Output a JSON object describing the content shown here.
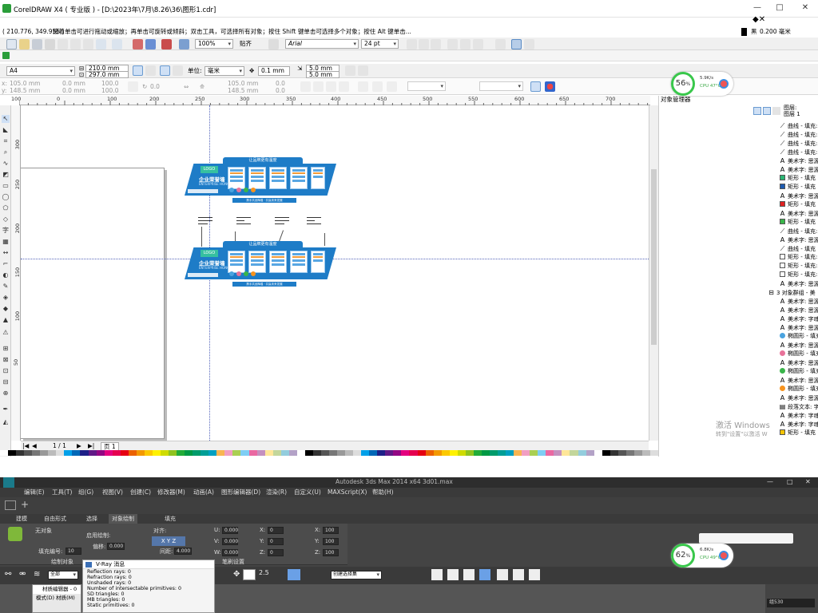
{
  "cdr": {
    "title": "CorelDRAW X4 ( 专业版 ) - [D:\\2023年\\7月\\8.26\\36\\图形1.cdr]",
    "window_controls": {
      "min": "—",
      "max": "□",
      "close": "✕"
    },
    "status": {
      "coords": "( 210.776, 349.955 )",
      "hint": "接着单击可进行拖动或缩放；再单击可旋转或倾斜；双击工具，可选择所有对象；按住 Shift 键单击可选择多个对象；按住 Alt 键单击...",
      "outline_label": "黑",
      "outline_width": "0.200 毫米"
    },
    "toolbar1": {
      "zoom": "100%",
      "snap": "贴齐",
      "font": "Arial",
      "font_size": "24 pt"
    },
    "propbar": {
      "paper": "A4",
      "width": "210.0 mm",
      "height": "297.0 mm",
      "units_label": "单位:",
      "units": "毫米",
      "nudge": "0.1 mm",
      "dup_x": "5.0 mm",
      "dup_y": "5.0 mm"
    },
    "propbar2": {
      "x": "105.0 mm",
      "y": "148.5 mm",
      "w": "0.0 mm",
      "h": "0.0 mm",
      "sx": "100.0",
      "sy": "100.0",
      "angle": "0.0",
      "cx": "105.0 mm",
      "cy": "148.5 mm",
      "v1": "0.0",
      "v2": "0.0"
    },
    "ruler_h_ticks": [
      "100",
      "50",
      "0",
      "50",
      "100",
      "150",
      "200",
      "250",
      "300",
      "350",
      "400",
      "450",
      "500",
      "550",
      "600",
      "650",
      "700"
    ],
    "ruler_v_ticks": [
      "300",
      "250",
      "200",
      "150",
      "100",
      "50",
      "0"
    ],
    "page_nav": {
      "counter": "1 / 1",
      "page_tab": "页 1"
    },
    "design": {
      "top_title": "让品牌更有温度",
      "badge": "LOGO",
      "company": "企业荣誉墙",
      "subtitle": "ENTERPRISE HONOR WALL",
      "footer": "携手共创辉煌 · 共赢未来发展",
      "top_title2": "让品牌更有温度",
      "badge2": "LOGO",
      "company2": "企业荣誉墙",
      "subtitle2": "ENTERPRISE HONOR WALL",
      "footer2": "携手共创辉煌 · 共赢未来发展"
    },
    "object_manager": {
      "title": "对象管理器",
      "layers": [
        "图层:",
        "图层 1"
      ],
      "rows": [
        {
          "icon": "curve",
          "text": "曲线 - 填充: 无"
        },
        {
          "icon": "curve",
          "text": "曲线 - 填充: 无"
        },
        {
          "icon": "curve",
          "text": "曲线 - 填充: 无"
        },
        {
          "icon": "curve",
          "text": "曲线 - 填充: 无"
        },
        {
          "icon": "text",
          "text": "美术字: 思源"
        },
        {
          "icon": "text",
          "text": "美术字: 思源"
        },
        {
          "icon": "rect",
          "color": "#2bb673",
          "text": "矩形 - 填充"
        },
        {
          "icon": "rect",
          "color": "#1e5bb0",
          "text": "矩形 - 填充"
        },
        {
          "icon": "text",
          "text": "美术字: 思源"
        },
        {
          "icon": "rect",
          "color": "#e02020",
          "text": "矩形 - 填充"
        },
        {
          "icon": "text",
          "text": "美术字: 思源"
        },
        {
          "icon": "rect",
          "color": "#39b54a",
          "text": "矩形 - 填充"
        },
        {
          "icon": "curve",
          "text": "曲线 - 填充: 白"
        },
        {
          "icon": "text",
          "text": "美术字: 思源"
        },
        {
          "icon": "curve",
          "text": "曲线 - 填充"
        },
        {
          "icon": "rect",
          "color": "#ffffff",
          "text": "矩形 - 填充: 白"
        },
        {
          "icon": "rect",
          "color": "#ffffff",
          "text": "矩形 - 填充: 白"
        },
        {
          "icon": "rect",
          "color": "#ffffff",
          "text": "矩形 - 填充: 白"
        },
        {
          "icon": "text",
          "text": "美术字: 思源"
        }
      ],
      "group": "3 对象群组 - 美",
      "group_rows": [
        {
          "icon": "text",
          "text": "美术字: 思源"
        },
        {
          "icon": "text",
          "text": "美术字: 思源"
        },
        {
          "icon": "text",
          "text": "美术字: 字魂"
        },
        {
          "icon": "text",
          "text": "美术字: 思源"
        },
        {
          "icon": "ellipse",
          "color": "#4aa3df",
          "text": "椭圆形 - 填充"
        },
        {
          "icon": "text",
          "text": "美术字: 思源"
        },
        {
          "icon": "ellipse",
          "color": "#e8739a",
          "text": "椭圆形 - 填充"
        },
        {
          "icon": "text",
          "text": "美术字: 思源"
        },
        {
          "icon": "ellipse",
          "color": "#39b54a",
          "text": "椭圆形 - 填充"
        },
        {
          "icon": "text",
          "text": "美术字: 思源"
        },
        {
          "icon": "ellipse",
          "color": "#f7931e",
          "text": "椭圆形 - 填充"
        },
        {
          "icon": "text",
          "text": "美术字: 思源"
        },
        {
          "icon": "para",
          "text": "段落文本: 字魂"
        },
        {
          "icon": "text",
          "text": "美术字: 字魂"
        },
        {
          "icon": "text",
          "text": "美术字: 字魂"
        },
        {
          "icon": "rect",
          "color": "#f5c400",
          "text": "矩形 - 填充"
        }
      ]
    }
  },
  "cpu1": {
    "percent": "56",
    "unit": "%",
    "speed": "5.9K/s",
    "cpu": "CPU 47°C"
  },
  "cpu2": {
    "percent": "62",
    "unit": "%",
    "speed": "6.8K/s",
    "cpu": "CPU 49°C"
  },
  "activate": {
    "line1": "激活 Windows",
    "line2": "转到\"设置\"以激活 W"
  },
  "max": {
    "title": "Autodesk 3ds Max  2014 x64    3d01.max",
    "menu": [
      "编辑(E)",
      "工具(T)",
      "组(G)",
      "视图(V)",
      "创建(C)",
      "修改器(M)",
      "动画(A)",
      "图形编辑器(D)",
      "渲染(R)",
      "自定义(U)",
      "MAXScript(X)",
      "帮助(H)"
    ],
    "tabs": [
      "建模",
      "自由形式",
      "选择",
      "对象绘制",
      "填充"
    ],
    "ribbon": {
      "no_object": "无对象",
      "fill_label": "填充编号:",
      "fill_value": "10",
      "paint_label": "启用绘制:",
      "offset_label": "偏移:",
      "offset_value": "0.000",
      "align_label": "对齐:",
      "spacing_label": "间距:",
      "spacing_value": "4.000",
      "u": "0.000",
      "v": "0.000",
      "w": "0.000",
      "xs": "0",
      "ys": "0",
      "zs": "0",
      "xv": "100",
      "yv": "100",
      "zv": "100",
      "paint_obj": "绘制对象",
      "brush_settings": "笔刷设置",
      "select_all": "全部",
      "sel_set": "创建选择集"
    },
    "vray": {
      "title": "V-Ray 消息",
      "lines": [
        "Reflection rays: 0",
        "Refraction rays: 0",
        "Unshaded rays: 0",
        "Number of intersectable primitives: 0",
        "SD triangles: 0",
        "MB triangles: 0",
        "Static primitives: 0"
      ]
    },
    "mated": {
      "title": "材质编辑器 - 0",
      "menu": "模式(D)  材质(M)"
    },
    "right_panel": "组530"
  }
}
